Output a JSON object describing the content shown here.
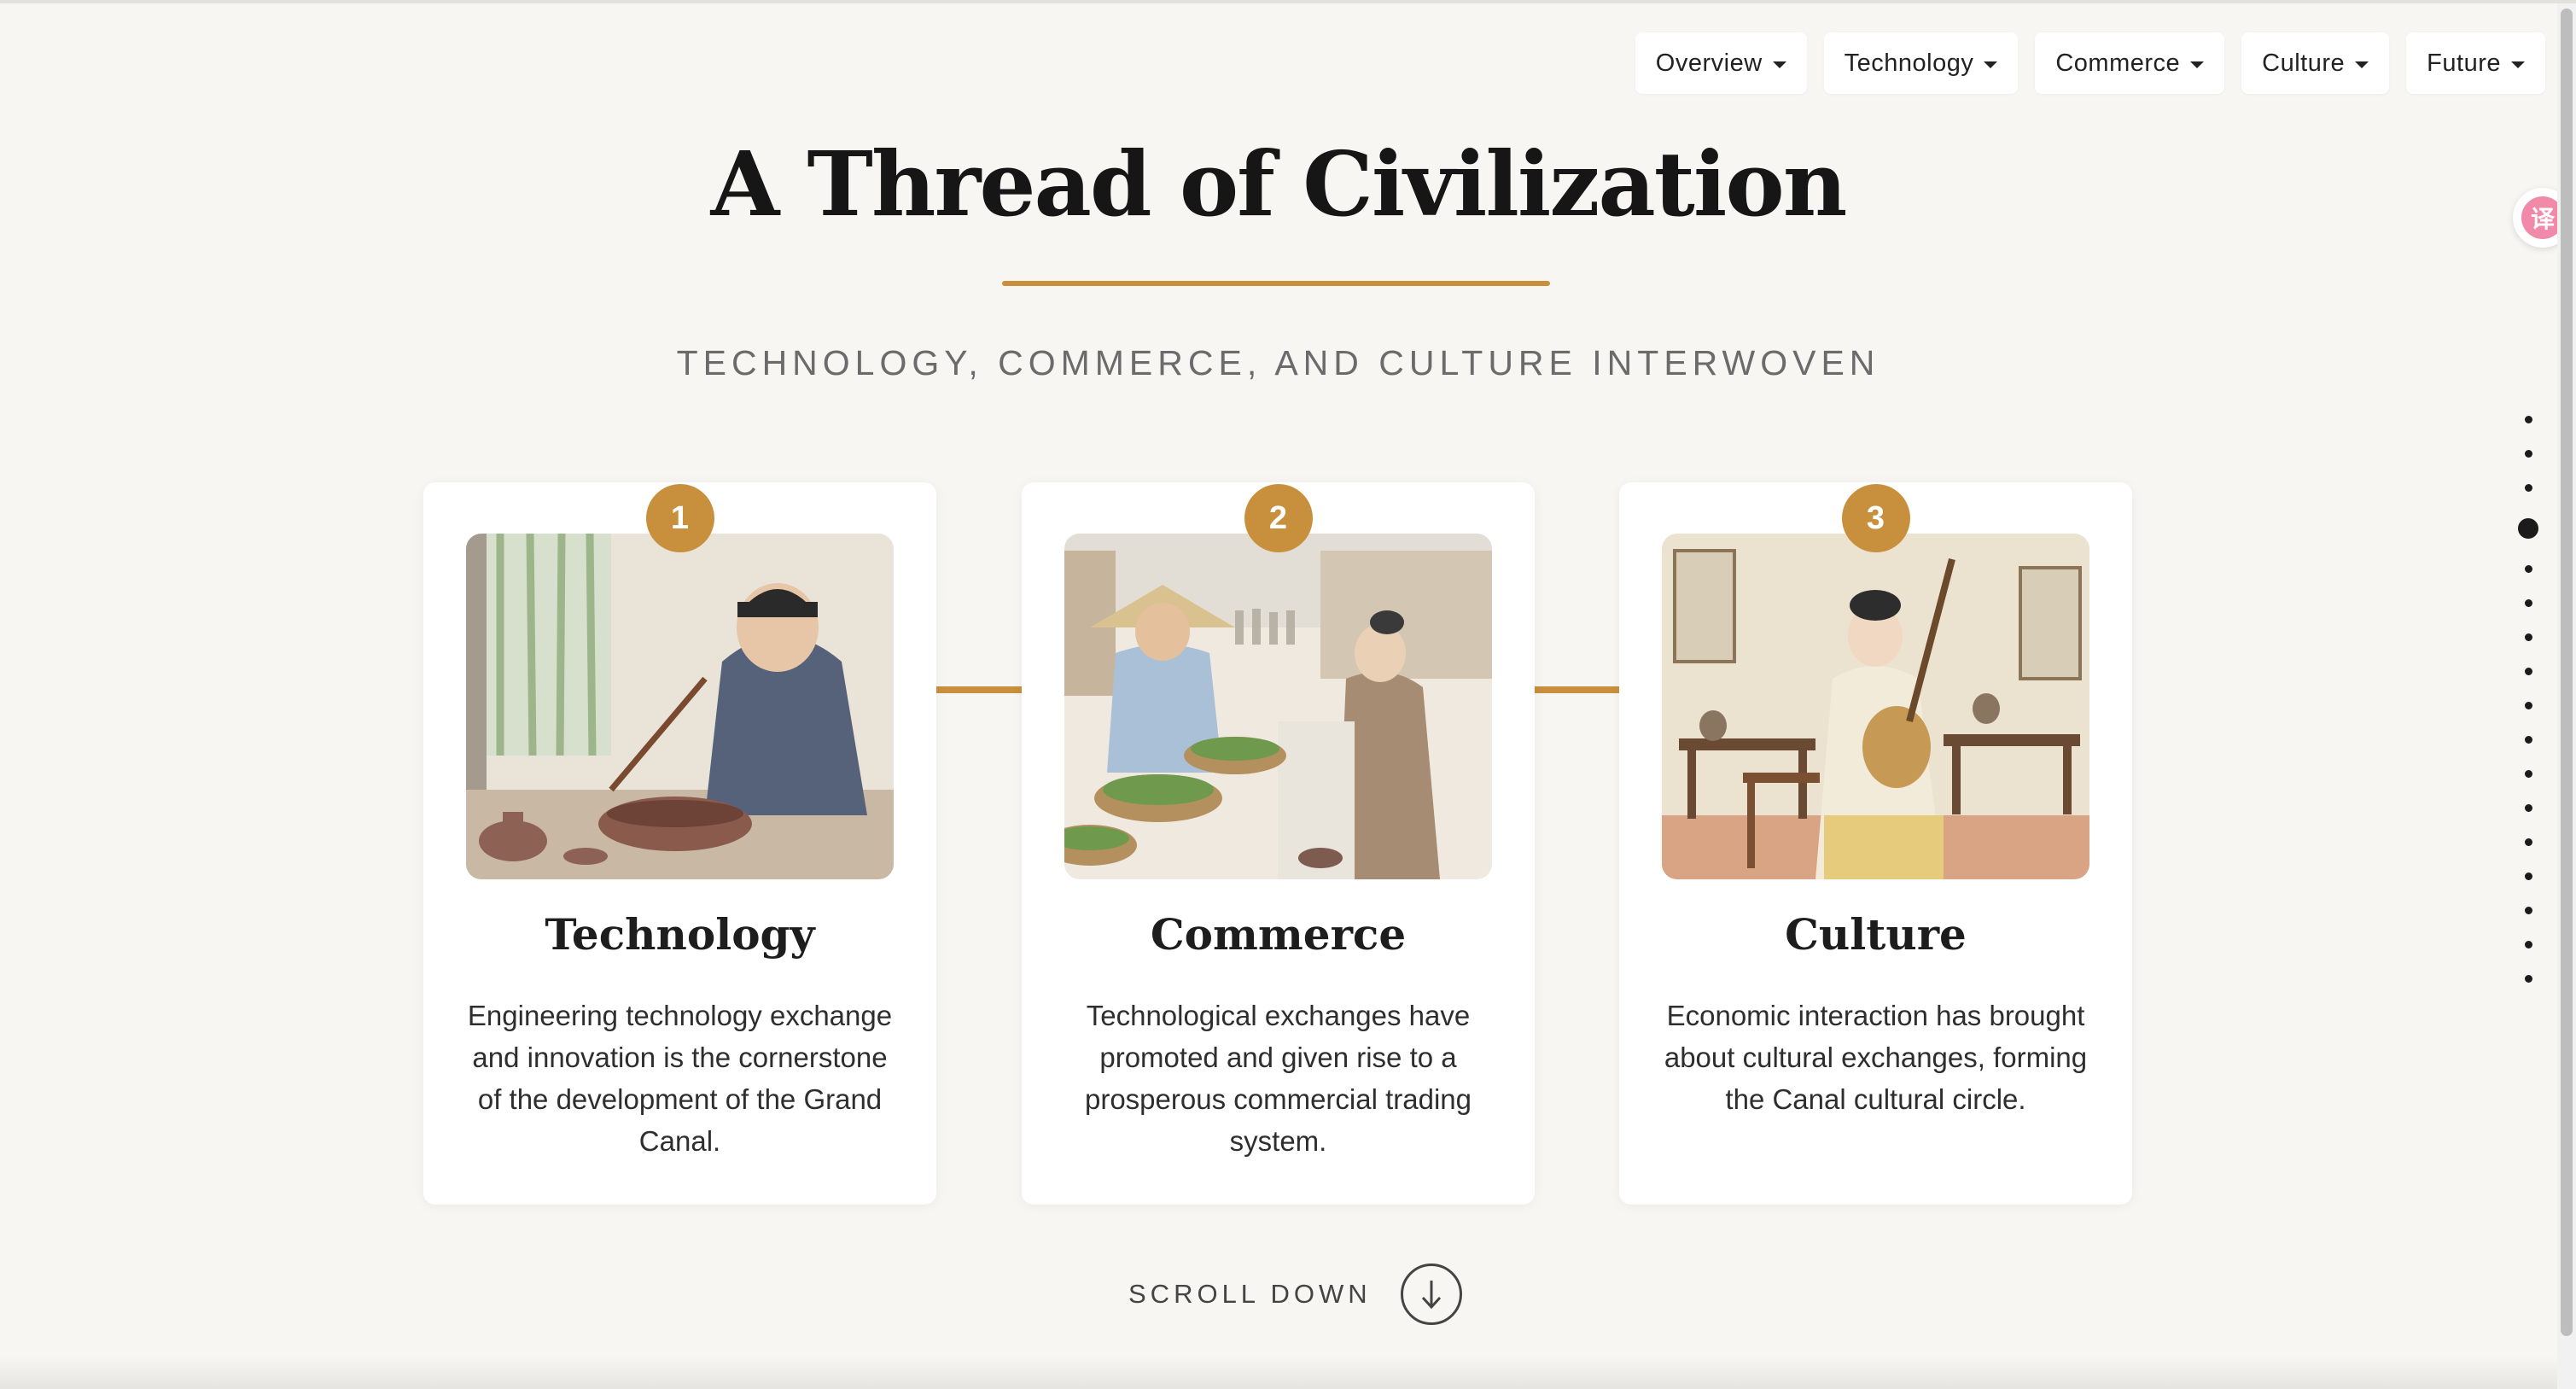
{
  "nav": {
    "items": [
      {
        "label": "Overview"
      },
      {
        "label": "Technology"
      },
      {
        "label": "Commerce"
      },
      {
        "label": "Culture"
      },
      {
        "label": "Future"
      }
    ]
  },
  "header": {
    "title": "A Thread of Civilization",
    "subtitle": "TECHNOLOGY, COMMERCE, AND CULTURE INTERWOVEN"
  },
  "cards": [
    {
      "number": "1",
      "title": "Technology",
      "text": "Engineering technology exchange and innovation is the cornerstone of the development of the Grand Canal."
    },
    {
      "number": "2",
      "title": "Commerce",
      "text": "Technological exchanges have promoted and given rise to a prosperous commercial trading system."
    },
    {
      "number": "3",
      "title": "Culture",
      "text": "Economic interaction has brought about cultural exchanges, forming the Canal cultural circle."
    }
  ],
  "scroll": {
    "label": "SCROLL DOWN",
    "icon": "arrow-down-icon"
  },
  "section_dots": {
    "count": 17,
    "active_index": 3
  },
  "translate_widget": {
    "glyph": "译",
    "icon": "translate-icon"
  },
  "colors": {
    "accent": "#c8903c",
    "background": "#f8f6f2",
    "card": "#ffffff"
  }
}
